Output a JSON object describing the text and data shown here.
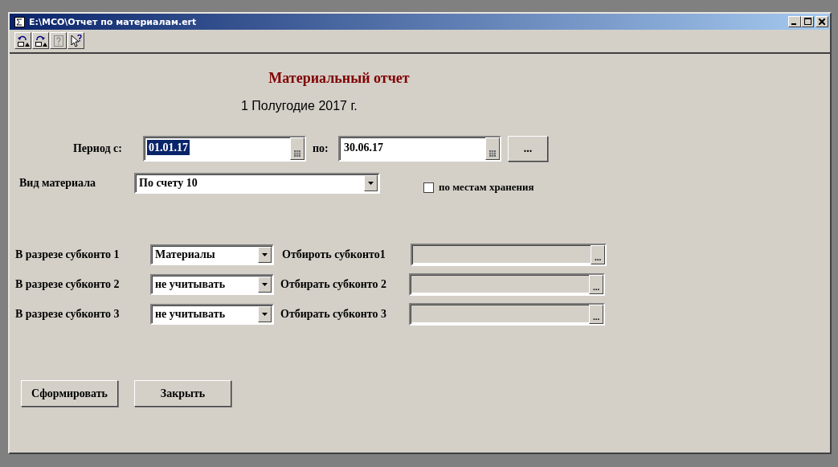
{
  "window": {
    "title": "E:\\МСО\\Отчет по материалам.ert"
  },
  "toolbar": [
    {
      "kind": "undo"
    },
    {
      "kind": "redo"
    },
    {
      "kind": "help",
      "disabled": true
    },
    {
      "kind": "whatsthis"
    }
  ],
  "form": {
    "heading": "Материальный отчет",
    "subheading": "1 Полугодие 2017 г.",
    "period_label": "Период с:",
    "period_from": {
      "value": "01.01.17",
      "highlighted": true
    },
    "to_label": "по:",
    "period_to": {
      "value": "30.06.17",
      "highlighted": false
    },
    "period_button": "...",
    "material_label": "Вид материала",
    "material_value": "По счету 10",
    "storage_checkbox": {
      "label": "по местам хранения",
      "checked": false
    },
    "rows": [
      {
        "label": "В разрезе субконто 1",
        "value": "Материалы",
        "filter_label": "Отбироть  субконто1",
        "filter_button": "..."
      },
      {
        "label": "В разрезе субконто 2",
        "value": "не учитывать",
        "filter_label": "Отбирать субконто 2",
        "filter_button": "..."
      },
      {
        "label": "В разрезе субконто 3",
        "value": "не учитывать",
        "filter_label": "Отбирать субконто 3",
        "filter_button": "..."
      }
    ],
    "buttons": [
      "Сформировать",
      "Закрыть"
    ]
  }
}
